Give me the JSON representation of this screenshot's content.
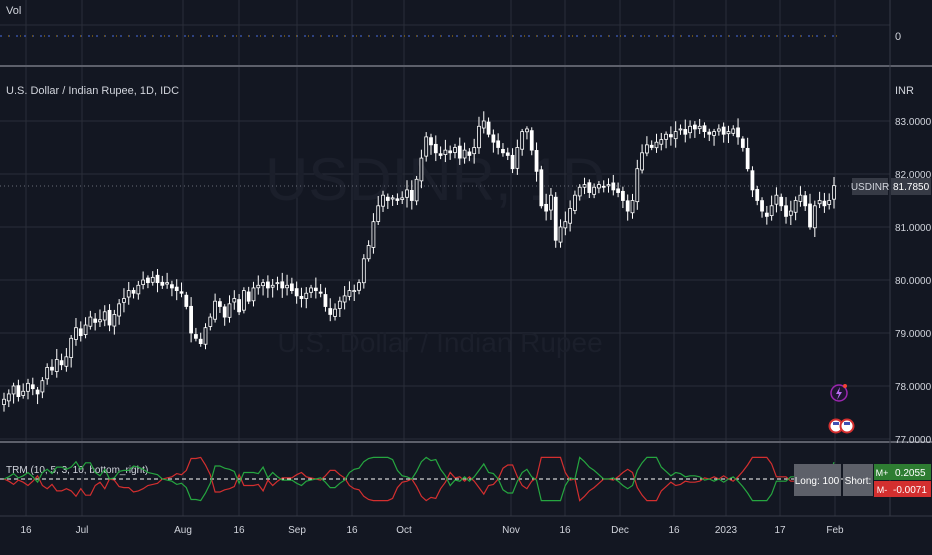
{
  "vol_pane": {
    "label": "Vol",
    "value": "0"
  },
  "main_pane": {
    "title": "U.S. Dollar / Indian Rupee, 1D, IDC",
    "currency": "INR",
    "watermark_symbol": "USDINR, 1D",
    "watermark_name": "U.S. Dollar / Indian Rupee",
    "price_tag_symbol": "USDINR",
    "price_tag_value": "81.7850",
    "y_ticks": [
      "83.0000",
      "82.0000",
      "81.0000",
      "80.0000",
      "79.0000",
      "78.0000",
      "77.0000"
    ]
  },
  "trm_pane": {
    "label": "TRM (10, 5, 3, 10, bottom_right)",
    "long_label": "Long: 100",
    "short_label": "Short:",
    "m_plus_label": "M+",
    "m_plus_value": "0.2055",
    "m_minus_label": "M-",
    "m_minus_value": "-0.0071"
  },
  "x_axis": {
    "ticks": [
      "16",
      "Jul",
      "Aug",
      "16",
      "Sep",
      "16",
      "Oct",
      "Nov",
      "16",
      "Dec",
      "16",
      "2023",
      "17",
      "Feb"
    ]
  },
  "colors": {
    "background": "#131722",
    "grid": "#2a2e39",
    "candle": "#ffffff",
    "trm_green": "#26a640",
    "trm_red": "#d32f2f",
    "price_tag": "#363a45",
    "m_plus_bg": "#2e7d32",
    "m_minus_bg": "#d32f2f",
    "badge_bg": "#5d6069"
  },
  "chart_data": {
    "type": "candlestick",
    "title": "U.S. Dollar / Indian Rupee, 1D, IDC",
    "period": "2022-06 to 2023-02",
    "ylim": [
      77.0,
      83.25
    ],
    "last_price": 81.785,
    "close": [
      77.75,
      77.85,
      78.0,
      77.8,
      77.9,
      78.05,
      77.95,
      77.85,
      78.1,
      78.35,
      78.3,
      78.5,
      78.4,
      78.55,
      78.9,
      79.1,
      78.95,
      79.15,
      79.3,
      79.2,
      79.25,
      79.4,
      79.15,
      79.35,
      79.55,
      79.65,
      79.8,
      79.75,
      79.9,
      80.0,
      79.95,
      80.05,
      79.95,
      79.9,
      79.95,
      79.85,
      79.8,
      79.75,
      79.5,
      79.0,
      78.9,
      78.8,
      79.1,
      79.3,
      79.6,
      79.5,
      79.3,
      79.55,
      79.65,
      79.4,
      79.8,
      79.6,
      79.85,
      79.9,
      79.95,
      79.85,
      79.9,
      79.95,
      79.85,
      79.9,
      79.8,
      79.7,
      79.65,
      79.75,
      79.85,
      79.8,
      79.75,
      79.5,
      79.35,
      79.45,
      79.6,
      79.7,
      79.8,
      79.8,
      79.95,
      80.4,
      80.65,
      81.1,
      81.4,
      81.6,
      81.5,
      81.55,
      81.5,
      81.55,
      81.7,
      81.5,
      81.9,
      82.3,
      82.7,
      82.55,
      82.4,
      82.35,
      82.45,
      82.4,
      82.5,
      82.3,
      82.45,
      82.35,
      82.5,
      82.9,
      83.0,
      82.75,
      82.6,
      82.5,
      82.4,
      82.35,
      82.1,
      82.5,
      82.8,
      82.85,
      82.45,
      82.05,
      81.4,
      81.3,
      81.6,
      80.75,
      81.0,
      81.1,
      81.35,
      81.6,
      81.75,
      81.8,
      81.65,
      81.75,
      81.8,
      81.75,
      81.8,
      81.7,
      81.65,
      81.5,
      81.3,
      81.5,
      82.1,
      82.4,
      82.55,
      82.5,
      82.6,
      82.65,
      82.75,
      82.7,
      82.8,
      82.85,
      82.75,
      82.9,
      82.85,
      82.9,
      82.8,
      82.75,
      82.8,
      82.85,
      82.75,
      82.8,
      82.85,
      82.7,
      82.5,
      82.1,
      81.7,
      81.5,
      81.3,
      81.2,
      81.4,
      81.6,
      81.4,
      81.2,
      81.3,
      81.5,
      81.6,
      81.4,
      81.0,
      81.4,
      81.5,
      81.4,
      81.5,
      81.78
    ]
  }
}
